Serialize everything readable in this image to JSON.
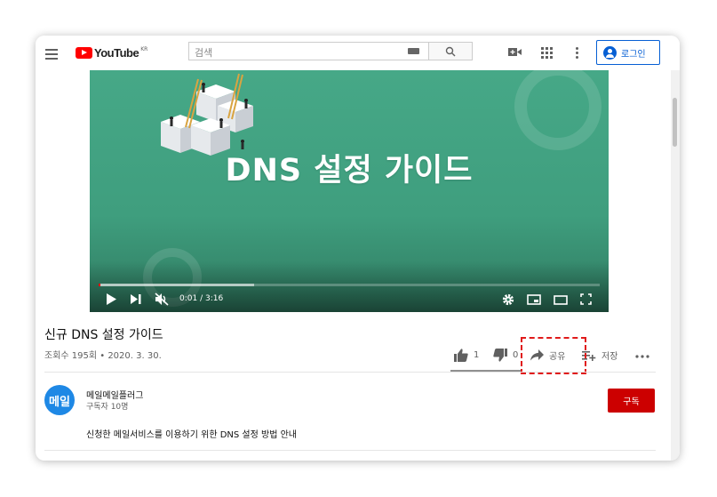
{
  "header": {
    "logo_text": "YouTube",
    "logo_region": "KR",
    "search_placeholder": "검색",
    "login_label": "로그인"
  },
  "player": {
    "video_text": "DNS 설정 가이드",
    "time_display": "0:01 / 3:16",
    "watched_fraction": 0.003,
    "buffered_fraction": 0.31
  },
  "video": {
    "title": "신규 DNS 설정 가이드",
    "views_date": "조회수 195회 • 2020. 3. 30.",
    "likes": "1",
    "dislikes": "0",
    "share_label": "공유",
    "save_label": "저장"
  },
  "channel": {
    "avatar_text": "메일",
    "name": "메일메일플러그",
    "subscribers": "구독자 10명",
    "subscribe_label": "구독",
    "description": "신청한 메일서비스를 이용하기 위한 DNS 설정 방법 안내"
  },
  "colors": {
    "brand_red": "#ff0000",
    "subscribe_red": "#cc0000",
    "link_blue": "#065fd4",
    "player_green": "#46a887",
    "highlight_red": "#e01a1a"
  }
}
